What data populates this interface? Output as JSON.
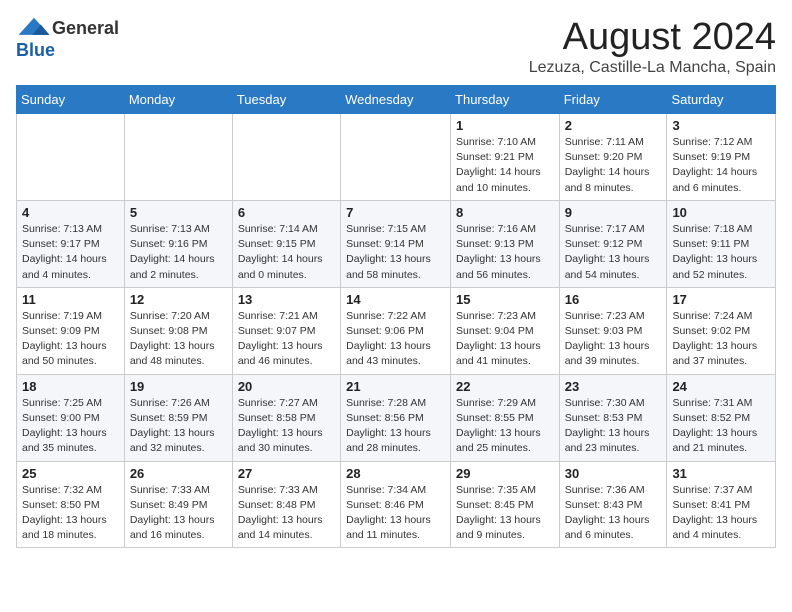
{
  "logo": {
    "general": "General",
    "blue": "Blue"
  },
  "title": "August 2024",
  "location": "Lezuza, Castille-La Mancha, Spain",
  "weekdays": [
    "Sunday",
    "Monday",
    "Tuesday",
    "Wednesday",
    "Thursday",
    "Friday",
    "Saturday"
  ],
  "weeks": [
    [
      {
        "day": "",
        "info": ""
      },
      {
        "day": "",
        "info": ""
      },
      {
        "day": "",
        "info": ""
      },
      {
        "day": "",
        "info": ""
      },
      {
        "day": "1",
        "info": "Sunrise: 7:10 AM\nSunset: 9:21 PM\nDaylight: 14 hours\nand 10 minutes."
      },
      {
        "day": "2",
        "info": "Sunrise: 7:11 AM\nSunset: 9:20 PM\nDaylight: 14 hours\nand 8 minutes."
      },
      {
        "day": "3",
        "info": "Sunrise: 7:12 AM\nSunset: 9:19 PM\nDaylight: 14 hours\nand 6 minutes."
      }
    ],
    [
      {
        "day": "4",
        "info": "Sunrise: 7:13 AM\nSunset: 9:17 PM\nDaylight: 14 hours\nand 4 minutes."
      },
      {
        "day": "5",
        "info": "Sunrise: 7:13 AM\nSunset: 9:16 PM\nDaylight: 14 hours\nand 2 minutes."
      },
      {
        "day": "6",
        "info": "Sunrise: 7:14 AM\nSunset: 9:15 PM\nDaylight: 14 hours\nand 0 minutes."
      },
      {
        "day": "7",
        "info": "Sunrise: 7:15 AM\nSunset: 9:14 PM\nDaylight: 13 hours\nand 58 minutes."
      },
      {
        "day": "8",
        "info": "Sunrise: 7:16 AM\nSunset: 9:13 PM\nDaylight: 13 hours\nand 56 minutes."
      },
      {
        "day": "9",
        "info": "Sunrise: 7:17 AM\nSunset: 9:12 PM\nDaylight: 13 hours\nand 54 minutes."
      },
      {
        "day": "10",
        "info": "Sunrise: 7:18 AM\nSunset: 9:11 PM\nDaylight: 13 hours\nand 52 minutes."
      }
    ],
    [
      {
        "day": "11",
        "info": "Sunrise: 7:19 AM\nSunset: 9:09 PM\nDaylight: 13 hours\nand 50 minutes."
      },
      {
        "day": "12",
        "info": "Sunrise: 7:20 AM\nSunset: 9:08 PM\nDaylight: 13 hours\nand 48 minutes."
      },
      {
        "day": "13",
        "info": "Sunrise: 7:21 AM\nSunset: 9:07 PM\nDaylight: 13 hours\nand 46 minutes."
      },
      {
        "day": "14",
        "info": "Sunrise: 7:22 AM\nSunset: 9:06 PM\nDaylight: 13 hours\nand 43 minutes."
      },
      {
        "day": "15",
        "info": "Sunrise: 7:23 AM\nSunset: 9:04 PM\nDaylight: 13 hours\nand 41 minutes."
      },
      {
        "day": "16",
        "info": "Sunrise: 7:23 AM\nSunset: 9:03 PM\nDaylight: 13 hours\nand 39 minutes."
      },
      {
        "day": "17",
        "info": "Sunrise: 7:24 AM\nSunset: 9:02 PM\nDaylight: 13 hours\nand 37 minutes."
      }
    ],
    [
      {
        "day": "18",
        "info": "Sunrise: 7:25 AM\nSunset: 9:00 PM\nDaylight: 13 hours\nand 35 minutes."
      },
      {
        "day": "19",
        "info": "Sunrise: 7:26 AM\nSunset: 8:59 PM\nDaylight: 13 hours\nand 32 minutes."
      },
      {
        "day": "20",
        "info": "Sunrise: 7:27 AM\nSunset: 8:58 PM\nDaylight: 13 hours\nand 30 minutes."
      },
      {
        "day": "21",
        "info": "Sunrise: 7:28 AM\nSunset: 8:56 PM\nDaylight: 13 hours\nand 28 minutes."
      },
      {
        "day": "22",
        "info": "Sunrise: 7:29 AM\nSunset: 8:55 PM\nDaylight: 13 hours\nand 25 minutes."
      },
      {
        "day": "23",
        "info": "Sunrise: 7:30 AM\nSunset: 8:53 PM\nDaylight: 13 hours\nand 23 minutes."
      },
      {
        "day": "24",
        "info": "Sunrise: 7:31 AM\nSunset: 8:52 PM\nDaylight: 13 hours\nand 21 minutes."
      }
    ],
    [
      {
        "day": "25",
        "info": "Sunrise: 7:32 AM\nSunset: 8:50 PM\nDaylight: 13 hours\nand 18 minutes."
      },
      {
        "day": "26",
        "info": "Sunrise: 7:33 AM\nSunset: 8:49 PM\nDaylight: 13 hours\nand 16 minutes."
      },
      {
        "day": "27",
        "info": "Sunrise: 7:33 AM\nSunset: 8:48 PM\nDaylight: 13 hours\nand 14 minutes."
      },
      {
        "day": "28",
        "info": "Sunrise: 7:34 AM\nSunset: 8:46 PM\nDaylight: 13 hours\nand 11 minutes."
      },
      {
        "day": "29",
        "info": "Sunrise: 7:35 AM\nSunset: 8:45 PM\nDaylight: 13 hours\nand 9 minutes."
      },
      {
        "day": "30",
        "info": "Sunrise: 7:36 AM\nSunset: 8:43 PM\nDaylight: 13 hours\nand 6 minutes."
      },
      {
        "day": "31",
        "info": "Sunrise: 7:37 AM\nSunset: 8:41 PM\nDaylight: 13 hours\nand 4 minutes."
      }
    ]
  ]
}
